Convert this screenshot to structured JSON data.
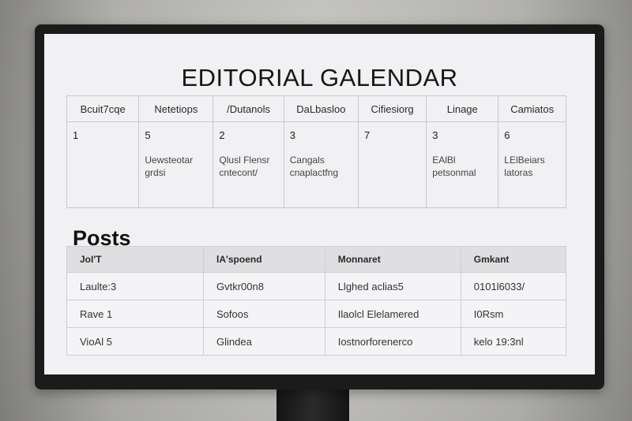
{
  "calendar": {
    "title": "EDITORIAL GALENDAR",
    "headers": [
      "Bcuit7cqe",
      "Netetiops",
      "/Dutanols",
      "DaLbasloo",
      "Cifiesiorg",
      "Linage",
      "Camiatos"
    ],
    "cells": [
      {
        "num": "1",
        "note": ""
      },
      {
        "num": "5",
        "note": "Uewsteotar\ngrdsi"
      },
      {
        "num": "2",
        "note": "Qlusl Flensr\ncntecont/"
      },
      {
        "num": "3",
        "note": "Cangals\ncnaplactfng"
      },
      {
        "num": "7",
        "note": ""
      },
      {
        "num": "3",
        "note": "EAlBl\npetsonmal"
      },
      {
        "num": "6",
        "note": "LElBeiars\nlatoras"
      }
    ]
  },
  "posts": {
    "heading": "Posts",
    "headers": [
      "JoI'T",
      "lA'spoend",
      "Monnaret",
      "Gmkant"
    ],
    "rows": [
      [
        "Laulte:3",
        "Gvtkr00n8",
        "Llghed aclias5",
        "0101l6033/"
      ],
      [
        "Rave 1",
        "Sofoos",
        "Ilaolcl Elelamered",
        "I0Rsm"
      ],
      [
        "VioAl 5",
        "Glindea",
        "Iostnorforenerco",
        "kelo 19:3nl"
      ]
    ]
  }
}
